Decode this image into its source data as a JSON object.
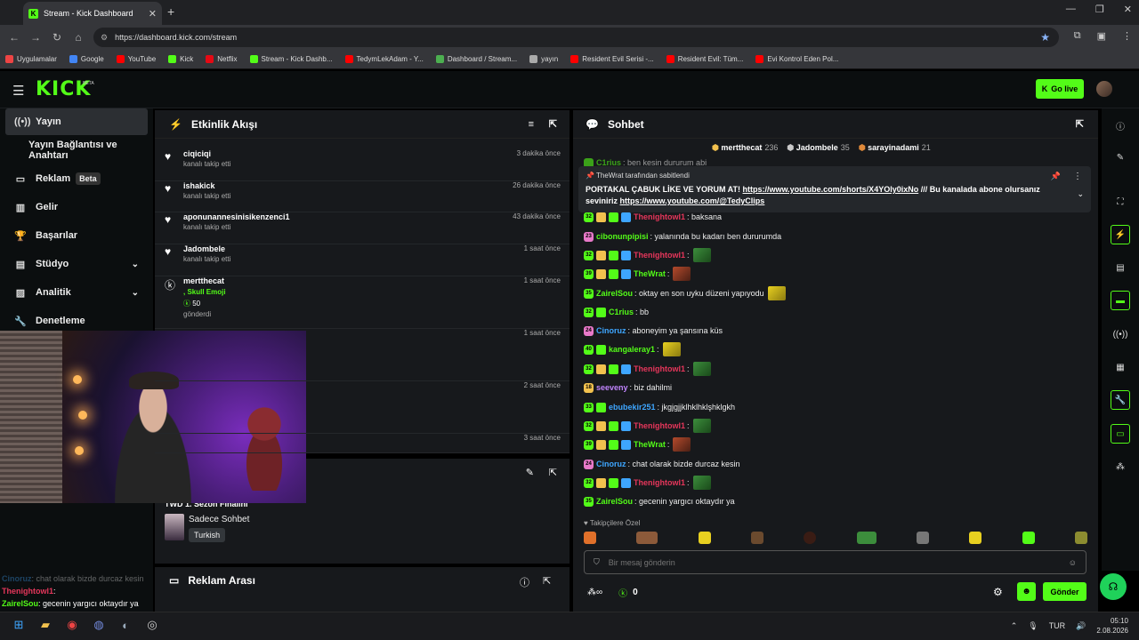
{
  "browser": {
    "tab_title": "Stream - Kick Dashboard",
    "url": "https://dashboard.kick.com/stream",
    "bookmarks": [
      "Uygulamalar",
      "Google",
      "YouTube",
      "Kick",
      "Netflix",
      "Stream - Kick Dashb...",
      "TedymLekAdam - Y...",
      "Dashboard / Stream...",
      "yayın",
      "Resident Evil Serisi -...",
      "Resident Evil: Tüm...",
      "Evi Kontrol Eden Pol..."
    ]
  },
  "header": {
    "logo": "KICK",
    "beta": "BETA",
    "go_live": "Go live"
  },
  "sidebar": {
    "items": [
      {
        "label": "Yayın",
        "icon": "broadcast-icon"
      },
      {
        "label": "Yayın Bağlantısı ve Anahtarı"
      },
      {
        "label": "Reklam",
        "icon": "ad-icon",
        "tag": "Beta"
      },
      {
        "label": "Gelir",
        "icon": "chart-icon"
      },
      {
        "label": "Başarılar",
        "icon": "trophy-icon"
      },
      {
        "label": "Stüdyo",
        "icon": "studio-icon"
      },
      {
        "label": "Analitik",
        "icon": "analytics-icon"
      },
      {
        "label": "Denetleme",
        "icon": "wrench-icon"
      }
    ]
  },
  "activity": {
    "title": "Etkinlik Akışı",
    "rows": [
      {
        "name": "ciqiciqi",
        "sub": "kanalı takip etti",
        "time": "3 dakika önce"
      },
      {
        "name": "ishakick",
        "sub": "kanalı takip etti",
        "time": "26 dakika önce"
      },
      {
        "name": "aponunannesinisikenzenci1",
        "sub": "kanalı takip etti",
        "time": "43 dakika önce"
      },
      {
        "name": "Jadombele",
        "sub": "kanalı takip etti",
        "time": "1 saat önce"
      },
      {
        "name": "mertthecat",
        "extra": ", Skull Emoji",
        "amount": "50",
        "sub": "gönderdi",
        "time": "1 saat önce"
      },
      {
        "time": "1 saat önce"
      },
      {
        "time": "2 saat önce"
      },
      {
        "time": "3 saat önce"
      }
    ]
  },
  "stream_info": {
    "title": "TWD 1. Sezon Finalini",
    "category": "Sadece Sohbet",
    "language": "Turkish"
  },
  "ad_break": {
    "title": "Reklam Arası"
  },
  "minichat": [
    {
      "user": "Cinoruz",
      "text": ": chat olarak bizde durcaz kesin"
    },
    {
      "user": "Thenightowl1",
      "text": ":"
    },
    {
      "user": "ZairelSou",
      "text": ": gecenin yargıcı oktaydır ya"
    }
  ],
  "chat": {
    "title": "Sohbet",
    "gifters": [
      {
        "name": "mertthecat",
        "count": "236"
      },
      {
        "name": "Jadombele",
        "count": "35"
      },
      {
        "name": "sarayinadami",
        "count": "21"
      }
    ],
    "pinned": {
      "by": "TheWrat tarafından sabitlendi",
      "text1": "PORTAKAL ÇABUK LİKE VE YORUM AT! ",
      "link1": "https://www.youtube.com/shorts/X4YOly0ixNo",
      "text2": " /// Bu kanalada abone olursanız seviniriz ",
      "link2": "https://www.youtube.com/@TedyClips"
    },
    "top_partial": {
      "user": "C1rius",
      "text": ": ben kesin dururum abi"
    },
    "messages": [
      {
        "badge": "32",
        "user": "Thenightowl1",
        "color": "#e6365b",
        "text": ": baksana"
      },
      {
        "badge": "23",
        "user": "cibonunpipisi",
        "color": "#53fc18",
        "text": ": yalanında bu kadarı ben dururumda"
      },
      {
        "badge": "32",
        "user": "Thenightowl1",
        "color": "#e6365b",
        "text": ":",
        "emote": true
      },
      {
        "badge": "39",
        "user": "TheWrat",
        "color": "#53fc18",
        "text": ":",
        "emote": true
      },
      {
        "badge": "35",
        "user": "ZairelSou",
        "color": "#53fc18",
        "text": ": oktay en son uyku düzeni yapıyodu",
        "emote": true
      },
      {
        "badge": "32",
        "user": "C1rius",
        "color": "#53fc18",
        "text": ": bb"
      },
      {
        "badge": "24",
        "user": "Cinoruz",
        "color": "#3ea6ff",
        "text": ": aboneyim ya şansına küs"
      },
      {
        "badge": "40",
        "user": "kangaleray1",
        "color": "#53fc18",
        "text": ":",
        "emote": true
      },
      {
        "badge": "32",
        "user": "Thenightowl1",
        "color": "#e6365b",
        "text": ":",
        "emote": true
      },
      {
        "badge": "18",
        "user": "seeveny",
        "color": "#c084fc",
        "text": ": biz dahilmi"
      },
      {
        "badge": "33",
        "user": "ebubekir251",
        "color": "#3ea6ff",
        "text": ": jkgjgjjklhklhklşhklgkh"
      },
      {
        "badge": "32",
        "user": "Thenightowl1",
        "color": "#e6365b",
        "text": ":",
        "emote": true
      },
      {
        "badge": "39",
        "user": "TheWrat",
        "color": "#53fc18",
        "text": ":",
        "emote": true
      },
      {
        "badge": "24",
        "user": "Cinoruz",
        "color": "#3ea6ff",
        "text": ": chat olarak bizde durcaz kesin"
      },
      {
        "badge": "32",
        "user": "Thenightowl1",
        "color": "#e6365b",
        "text": ":",
        "emote": true
      },
      {
        "badge": "35",
        "user": "ZairelSou",
        "color": "#53fc18",
        "text": ": gecenin yargıcı oktaydır ya"
      }
    ],
    "followers_only": "Takipçilere Özel",
    "input_placeholder": "Bir mesaj gönderin",
    "points": "0",
    "send": "Gönder"
  },
  "taskbar": {
    "lang": "TUR",
    "time": "05:10",
    "date": "2.08.2026"
  },
  "colors": {
    "accent": "#53fc18",
    "bg": "#0b0e0f",
    "panel": "#17191c"
  }
}
